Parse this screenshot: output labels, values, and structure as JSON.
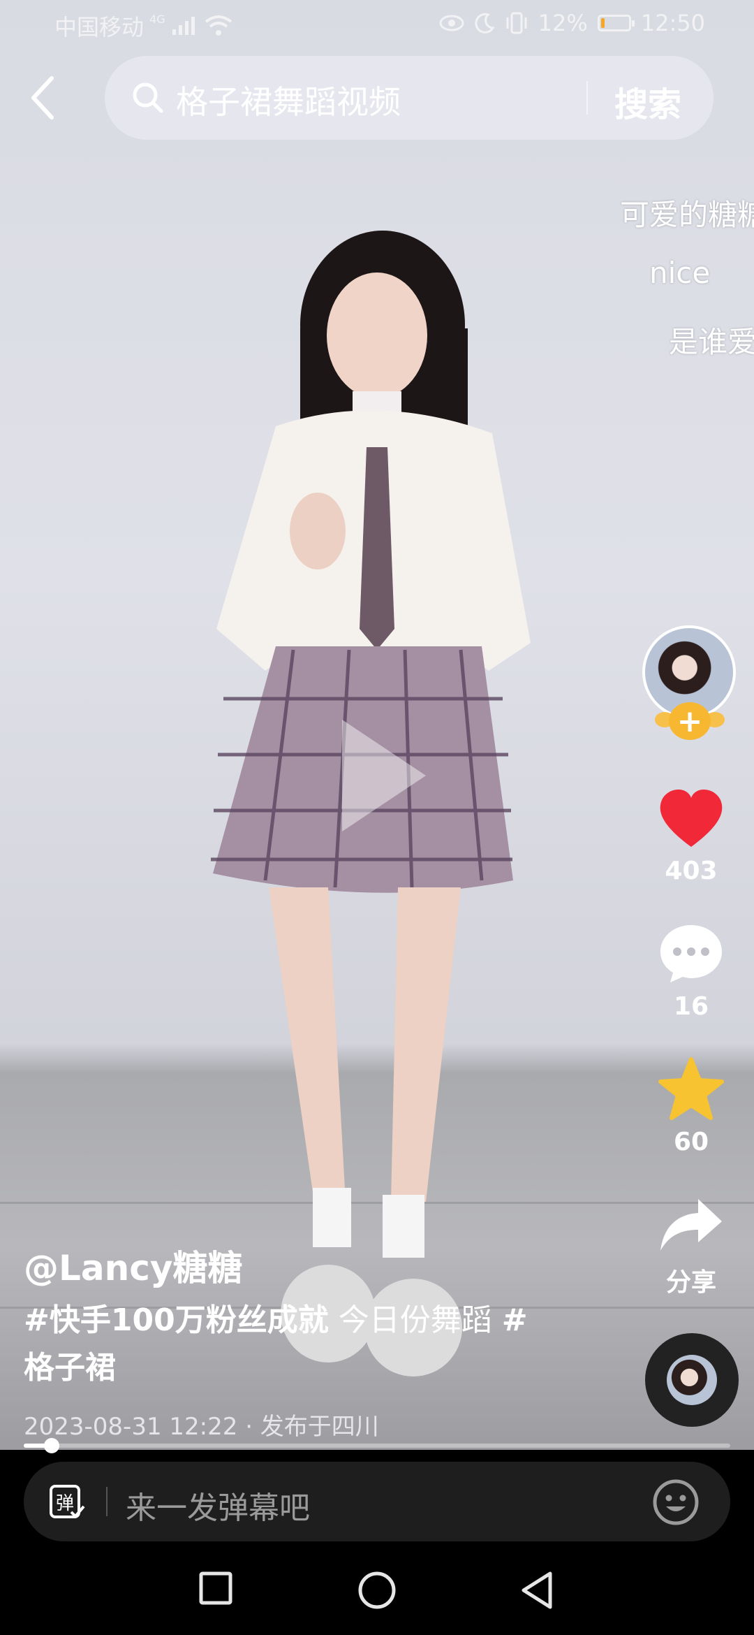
{
  "status_bar": {
    "carrier": "中国移动",
    "network": "4G",
    "battery": "12%",
    "battery_level": 0.12,
    "time": "12:50",
    "icons": [
      "signal-icon",
      "wifi-icon",
      "eye-icon",
      "moon-icon",
      "vibrate-icon",
      "battery-icon"
    ]
  },
  "header": {
    "search_query": "格子裙舞蹈视频",
    "search_button": "搜索"
  },
  "danmaku": [
    {
      "text": "可爱的糖糖"
    },
    {
      "text": "nice"
    },
    {
      "text": "是谁爱"
    }
  ],
  "actions": {
    "likes": "403",
    "comments": "16",
    "favorites": "60",
    "share": "分享",
    "colors": {
      "like": "#f02838",
      "favorite": "#f7c331",
      "follow": "#f7b731"
    }
  },
  "post": {
    "author": "@Lancy糖糖",
    "caption_tag1": "#快手100万粉丝成就",
    "caption_text": " 今日份舞蹈 ",
    "caption_tag2": "#格子裙",
    "meta": "2023-08-31 12:22 · 发布于四川",
    "progress": 0.04
  },
  "comment_bar": {
    "placeholder": "来一发弹幕吧",
    "danmaku_toggle_label": "弹"
  },
  "nav": {
    "icons": [
      "recents-square-icon",
      "home-circle-icon",
      "back-triangle-icon"
    ]
  }
}
